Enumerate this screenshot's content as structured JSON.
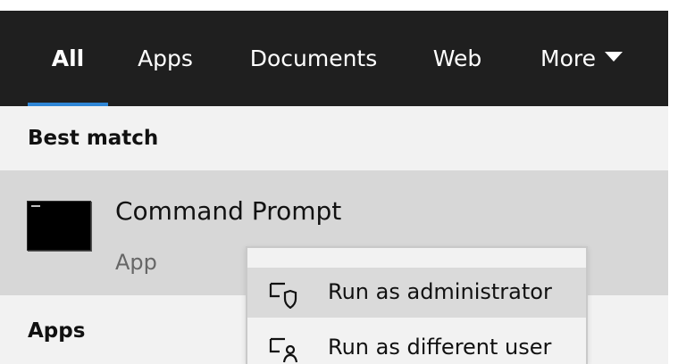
{
  "tabs": [
    {
      "label": "All",
      "active": true
    },
    {
      "label": "Apps",
      "active": false
    },
    {
      "label": "Documents",
      "active": false
    },
    {
      "label": "Web",
      "active": false
    },
    {
      "label": "More",
      "active": false
    }
  ],
  "sections": {
    "best_match": "Best match",
    "apps": "Apps"
  },
  "best_match_result": {
    "title": "Command Prompt",
    "type": "App",
    "icon": "command-prompt-icon"
  },
  "context_menu": {
    "items": [
      {
        "label": "Run as administrator",
        "icon": "shield-icon"
      },
      {
        "label": "Run as different user",
        "icon": "different-user-icon"
      }
    ]
  },
  "colors": {
    "tab_bar": "#1f1f1f",
    "accent": "#2f86d6",
    "content_background": "#f2f2f2",
    "selected_result": "#d7d7d7",
    "context_menu_hover": "#dadada"
  }
}
